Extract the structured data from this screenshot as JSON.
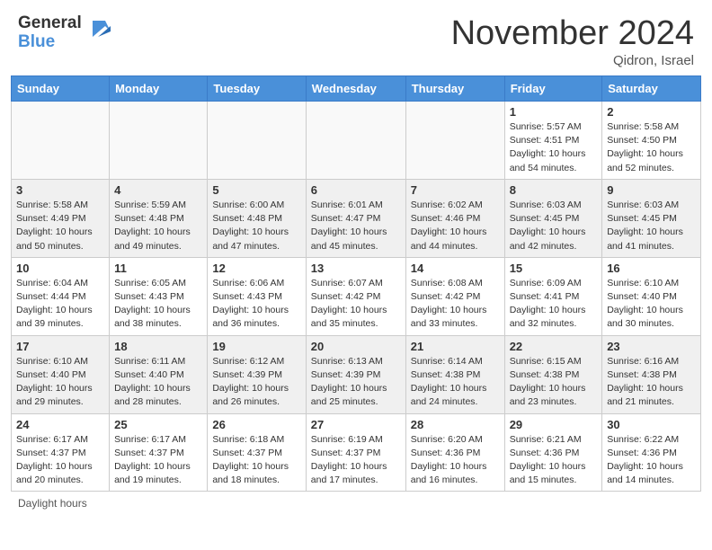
{
  "header": {
    "logo_general": "General",
    "logo_blue": "Blue",
    "month_title": "November 2024",
    "location": "Qidron, Israel"
  },
  "footer": {
    "daylight_label": "Daylight hours"
  },
  "weekdays": [
    "Sunday",
    "Monday",
    "Tuesday",
    "Wednesday",
    "Thursday",
    "Friday",
    "Saturday"
  ],
  "weeks": [
    [
      {
        "num": "",
        "info": ""
      },
      {
        "num": "",
        "info": ""
      },
      {
        "num": "",
        "info": ""
      },
      {
        "num": "",
        "info": ""
      },
      {
        "num": "",
        "info": ""
      },
      {
        "num": "1",
        "info": "Sunrise: 5:57 AM\nSunset: 4:51 PM\nDaylight: 10 hours\nand 54 minutes."
      },
      {
        "num": "2",
        "info": "Sunrise: 5:58 AM\nSunset: 4:50 PM\nDaylight: 10 hours\nand 52 minutes."
      }
    ],
    [
      {
        "num": "3",
        "info": "Sunrise: 5:58 AM\nSunset: 4:49 PM\nDaylight: 10 hours\nand 50 minutes."
      },
      {
        "num": "4",
        "info": "Sunrise: 5:59 AM\nSunset: 4:48 PM\nDaylight: 10 hours\nand 49 minutes."
      },
      {
        "num": "5",
        "info": "Sunrise: 6:00 AM\nSunset: 4:48 PM\nDaylight: 10 hours\nand 47 minutes."
      },
      {
        "num": "6",
        "info": "Sunrise: 6:01 AM\nSunset: 4:47 PM\nDaylight: 10 hours\nand 45 minutes."
      },
      {
        "num": "7",
        "info": "Sunrise: 6:02 AM\nSunset: 4:46 PM\nDaylight: 10 hours\nand 44 minutes."
      },
      {
        "num": "8",
        "info": "Sunrise: 6:03 AM\nSunset: 4:45 PM\nDaylight: 10 hours\nand 42 minutes."
      },
      {
        "num": "9",
        "info": "Sunrise: 6:03 AM\nSunset: 4:45 PM\nDaylight: 10 hours\nand 41 minutes."
      }
    ],
    [
      {
        "num": "10",
        "info": "Sunrise: 6:04 AM\nSunset: 4:44 PM\nDaylight: 10 hours\nand 39 minutes."
      },
      {
        "num": "11",
        "info": "Sunrise: 6:05 AM\nSunset: 4:43 PM\nDaylight: 10 hours\nand 38 minutes."
      },
      {
        "num": "12",
        "info": "Sunrise: 6:06 AM\nSunset: 4:43 PM\nDaylight: 10 hours\nand 36 minutes."
      },
      {
        "num": "13",
        "info": "Sunrise: 6:07 AM\nSunset: 4:42 PM\nDaylight: 10 hours\nand 35 minutes."
      },
      {
        "num": "14",
        "info": "Sunrise: 6:08 AM\nSunset: 4:42 PM\nDaylight: 10 hours\nand 33 minutes."
      },
      {
        "num": "15",
        "info": "Sunrise: 6:09 AM\nSunset: 4:41 PM\nDaylight: 10 hours\nand 32 minutes."
      },
      {
        "num": "16",
        "info": "Sunrise: 6:10 AM\nSunset: 4:40 PM\nDaylight: 10 hours\nand 30 minutes."
      }
    ],
    [
      {
        "num": "17",
        "info": "Sunrise: 6:10 AM\nSunset: 4:40 PM\nDaylight: 10 hours\nand 29 minutes."
      },
      {
        "num": "18",
        "info": "Sunrise: 6:11 AM\nSunset: 4:40 PM\nDaylight: 10 hours\nand 28 minutes."
      },
      {
        "num": "19",
        "info": "Sunrise: 6:12 AM\nSunset: 4:39 PM\nDaylight: 10 hours\nand 26 minutes."
      },
      {
        "num": "20",
        "info": "Sunrise: 6:13 AM\nSunset: 4:39 PM\nDaylight: 10 hours\nand 25 minutes."
      },
      {
        "num": "21",
        "info": "Sunrise: 6:14 AM\nSunset: 4:38 PM\nDaylight: 10 hours\nand 24 minutes."
      },
      {
        "num": "22",
        "info": "Sunrise: 6:15 AM\nSunset: 4:38 PM\nDaylight: 10 hours\nand 23 minutes."
      },
      {
        "num": "23",
        "info": "Sunrise: 6:16 AM\nSunset: 4:38 PM\nDaylight: 10 hours\nand 21 minutes."
      }
    ],
    [
      {
        "num": "24",
        "info": "Sunrise: 6:17 AM\nSunset: 4:37 PM\nDaylight: 10 hours\nand 20 minutes."
      },
      {
        "num": "25",
        "info": "Sunrise: 6:17 AM\nSunset: 4:37 PM\nDaylight: 10 hours\nand 19 minutes."
      },
      {
        "num": "26",
        "info": "Sunrise: 6:18 AM\nSunset: 4:37 PM\nDaylight: 10 hours\nand 18 minutes."
      },
      {
        "num": "27",
        "info": "Sunrise: 6:19 AM\nSunset: 4:37 PM\nDaylight: 10 hours\nand 17 minutes."
      },
      {
        "num": "28",
        "info": "Sunrise: 6:20 AM\nSunset: 4:36 PM\nDaylight: 10 hours\nand 16 minutes."
      },
      {
        "num": "29",
        "info": "Sunrise: 6:21 AM\nSunset: 4:36 PM\nDaylight: 10 hours\nand 15 minutes."
      },
      {
        "num": "30",
        "info": "Sunrise: 6:22 AM\nSunset: 4:36 PM\nDaylight: 10 hours\nand 14 minutes."
      }
    ]
  ]
}
